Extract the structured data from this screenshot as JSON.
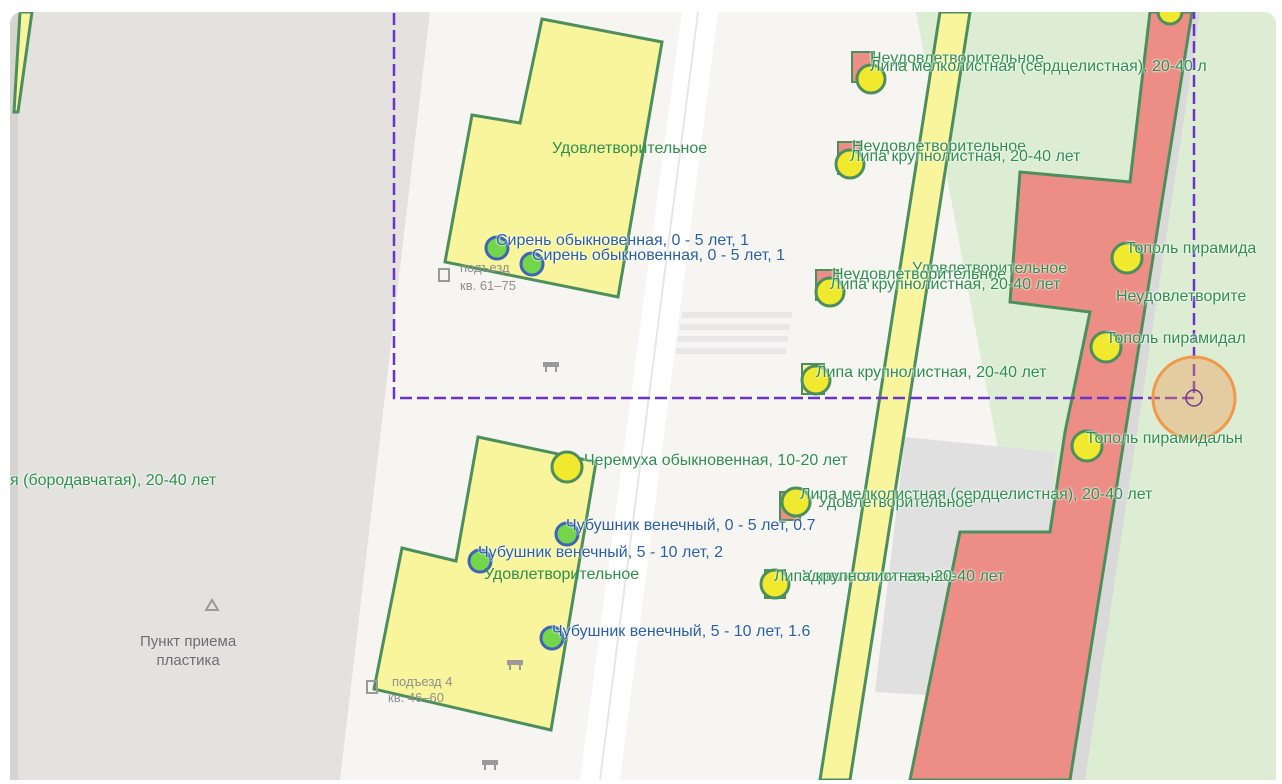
{
  "colors": {
    "satisfactory_fill": "#f8f59d",
    "unsatisfactory_fill": "#ec8e86",
    "polygon_stroke": "#4c8f5c",
    "tree_fill": "#f1e92e",
    "shrub_fill": "#73d64a",
    "shrub_stroke": "#3f63b8",
    "selection_dash": "#6b33c8",
    "cursor_ring": "#f0994b",
    "label_green": "#2f8f4e",
    "label_blue": "#2b5fa8"
  },
  "map": {
    "poi": {
      "recycle_title": "Пункт приема\nпластика",
      "entrance_4": "подъезд 4",
      "apartments_4": "кв. 46–60",
      "entrance_top": "подъезд",
      "apartments_top": "кв. 61–75"
    },
    "zone_labels": {
      "zone_upper": "Удовлетворительное",
      "zone_lower": "Удовлетворительное",
      "strip_status": "Удовлетворительное",
      "red_strip_status": "Неудовлетворите"
    },
    "tree_labels": {
      "t1_status": "Неудовлетворительное",
      "t1_name": "Липа мелколистная (сердцелистная), 20-40 л",
      "t2_status": "Неудовлетворительное",
      "t2_name": "Липа крупнолистная, 20-40 лет",
      "t3_status": "Неудовлетворительное",
      "t3_name": "Липа крупнолистная, 20-40 лет",
      "t4_name": "Липа крупнолистная, 20-40 лет",
      "t5_status": "Удовлетворительное",
      "t5_name": "Липа мелколистная (сердцелистная), 20-40 лет",
      "t6_status": "Удовлетворительное",
      "t6_name": "Липа крупнолистная, 20-40 лет",
      "cherry": "Черемуха обыкновенная, 10-20 лет",
      "birch": "я (бородавчатая), 20-40 лет",
      "poplar1": "Тополь пирамида",
      "poplar2": "Тополь пирамидал",
      "poplar3": "Тополь пирамидальн"
    },
    "shrub_labels": {
      "lilac1": "Сирень обыкновенная, 0 - 5 лет, 1",
      "lilac2": "Сирень обыкновенная, 0 - 5 лет, 1",
      "mock1": "Чубушник венечный, 0 - 5 лет, 0.7",
      "mock2": "Чубушник венечный, 5 - 10 лет, 2",
      "mock3": "Чубушник венечный, 5 - 10 лет, 1.6"
    }
  }
}
